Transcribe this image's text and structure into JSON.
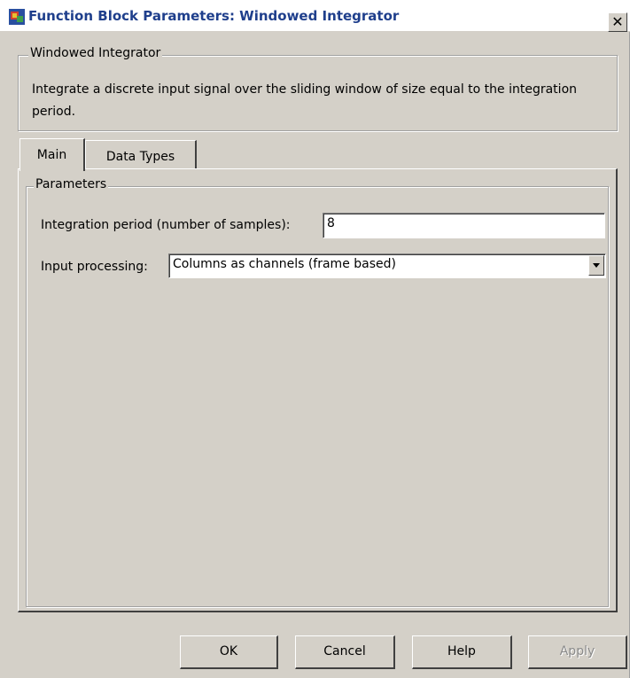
{
  "window": {
    "title": "Function Block Parameters: Windowed Integrator",
    "close_glyph": "✕"
  },
  "block": {
    "name": "Windowed Integrator",
    "description": "Integrate a discrete input signal over the sliding window of size equal to the integration period."
  },
  "tabs": [
    {
      "label": "Main",
      "active": true
    },
    {
      "label": "Data Types",
      "active": false
    }
  ],
  "parameters": {
    "group_label": "Parameters",
    "integration_period": {
      "label": "Integration period (number of samples):",
      "value": "8"
    },
    "input_processing": {
      "label": "Input processing:",
      "selected": "Columns as channels (frame based)"
    }
  },
  "buttons": {
    "ok": "OK",
    "cancel": "Cancel",
    "help": "Help",
    "apply": "Apply"
  },
  "colors": {
    "title_text": "#1f3f8c",
    "dialog_bg": "#d4d0c8"
  }
}
